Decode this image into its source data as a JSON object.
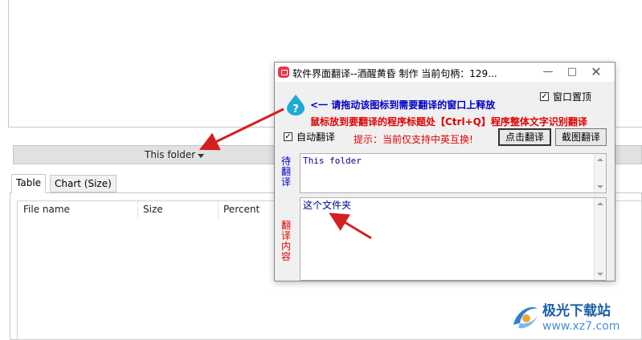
{
  "background_app": {
    "folder_button_label": "This folder",
    "tabs": [
      "Table",
      "Chart (Size)"
    ],
    "columns": [
      "File name",
      "Size",
      "Percent"
    ]
  },
  "translator": {
    "title": "软件界面翻译--酒醒黄昏 制作  当前句柄：129...",
    "window_controls": [
      "minimize",
      "maximize",
      "close"
    ],
    "hint_drag": "<一 请拖动该图标到需要翻译的窗口上释放",
    "hint_titlebar": "鼠标放到要翻译的程序标题处【Ctrl+Q】程序整体文字识别翻译",
    "always_on_top_label": "窗口置顶",
    "always_on_top_checked": true,
    "auto_translate_label": "自动翻译",
    "auto_translate_checked": true,
    "tip": "提示：当前仅支持中英互换!",
    "translate_button": "点击翻译",
    "screenshot_button": "截图翻译",
    "source_label": "待翻译",
    "source_text": "This folder",
    "result_label": "翻译内容",
    "result_text": "这个文件夹"
  },
  "watermark": {
    "name": "极光下载站",
    "url": "www.xz7.com"
  },
  "colors": {
    "hint_blue": "#0000c8",
    "hint_red": "#e00000",
    "arrow_red": "#d42020",
    "watermark_blue": "#1a5fa8"
  }
}
